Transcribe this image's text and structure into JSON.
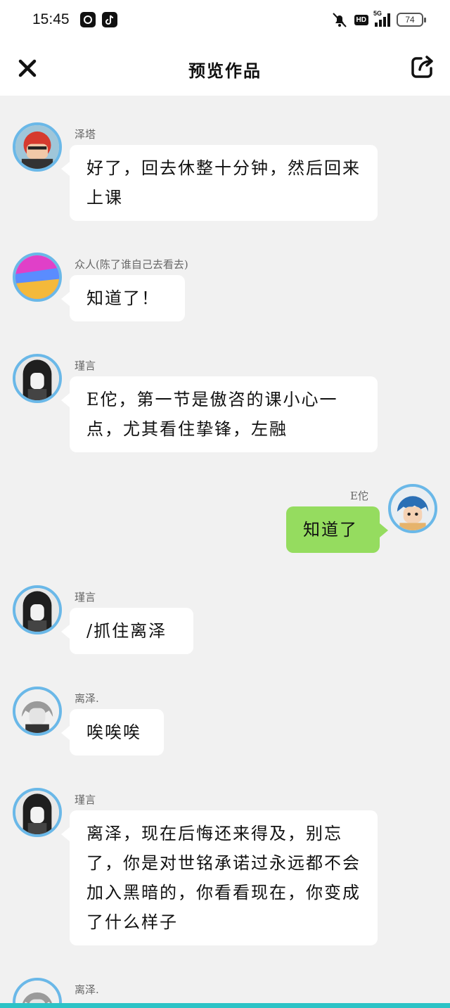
{
  "status_bar": {
    "time": "15:45",
    "network": "5G",
    "hd": "HD",
    "battery": "74"
  },
  "header": {
    "title": "预览作品",
    "close_icon": "close-icon",
    "share_icon": "share-icon"
  },
  "messages": [
    {
      "side": "left",
      "sender": "泽塔",
      "text": "好了，回去休整十分钟，然后回来上课",
      "avatar": "red-hair-boy"
    },
    {
      "side": "left",
      "sender": "众人(陈了谁自己去看去)",
      "text": "知道了！",
      "avatar": "rainbow-gradient"
    },
    {
      "side": "left",
      "sender": "瑾言",
      "text": "E佗，第一节是傲咨的课小心一点，尤其看住挚锋，左融",
      "avatar": "dark-hair-girl"
    },
    {
      "side": "right",
      "sender": "E佗",
      "text": "知道了",
      "avatar": "blue-hair-boy"
    },
    {
      "side": "left",
      "sender": "瑾言",
      "text": "/抓住离泽",
      "avatar": "dark-hair-girl"
    },
    {
      "side": "left",
      "sender": "离泽.",
      "text": "唉唉唉",
      "avatar": "grey-hair-boy"
    },
    {
      "side": "left",
      "sender": "瑾言",
      "text": "离泽，现在后悔还来得及，别忘了，你是对世铭承诺过永远都不会加入黑暗的，你看看现在，你变成了什么样子",
      "avatar": "dark-hair-girl"
    },
    {
      "side": "left",
      "sender": "离泽.",
      "text": "",
      "avatar": "grey-hair-boy"
    }
  ],
  "colors": {
    "avatar_ring": "#6ab8e8",
    "self_bubble": "#95dc5f",
    "bottom_accent": "#2cc3c6"
  }
}
